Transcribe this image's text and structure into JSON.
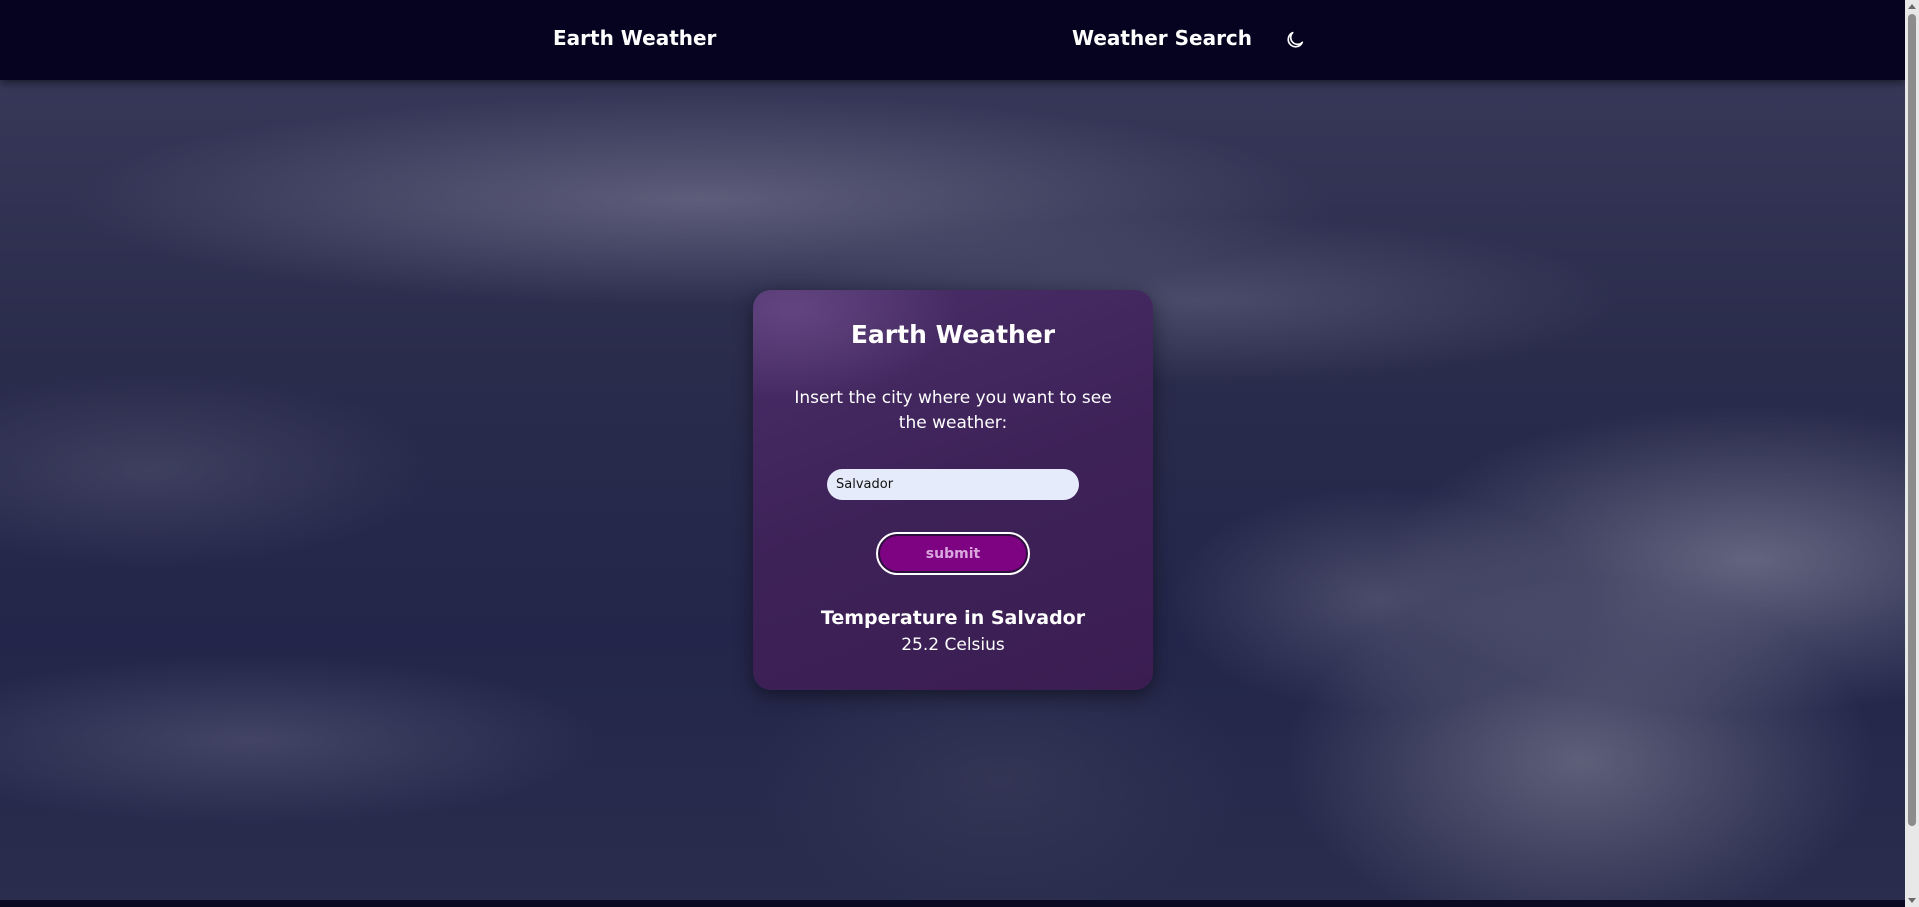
{
  "navbar": {
    "brand": "Earth Weather",
    "link": "Weather Search",
    "theme_icon": "moon-icon"
  },
  "card": {
    "title": "Earth Weather",
    "prompt": "Insert the city where you want to see the weather:",
    "input_value": "Salvador",
    "submit_label": "submit",
    "result_heading": "Temperature in Salvador",
    "result_value": "25.2 Celsius"
  },
  "colors": {
    "navbar_bg": "#05031f",
    "card_bg": "#3d2258",
    "button_bg": "#7e0383",
    "input_bg": "#e6ebfb"
  }
}
